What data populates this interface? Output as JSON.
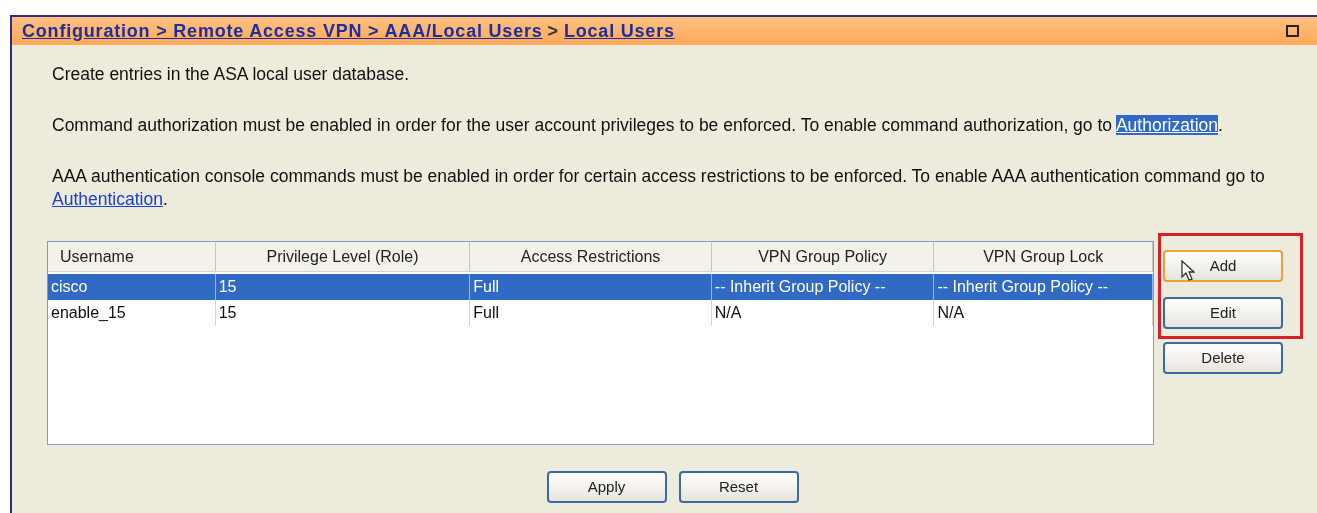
{
  "breadcrumb": [
    {
      "kind": "link",
      "text": "Configuration > Remote Access VPN > AAA/Local Users"
    },
    {
      "kind": "separator",
      "text": ">"
    },
    {
      "kind": "link",
      "text": "Local Users"
    }
  ],
  "paragraphs": [
    [
      {
        "kind": "text",
        "text": "Create entries in the ASA local user database."
      }
    ],
    [
      {
        "kind": "text",
        "text": "Command authorization must be enabled in order for the user account privileges to be enforced. To enable command authorization, go to "
      },
      {
        "kind": "link",
        "text": "Authorization",
        "highlighted": true
      },
      {
        "kind": "text",
        "text": "."
      }
    ],
    [
      {
        "kind": "text",
        "text": "AAA authentication console commands must be enabled in order for certain access restrictions to be enforced. To enable AAA authentication command go to "
      },
      {
        "kind": "link",
        "text": "Authentication",
        "highlighted": false
      },
      {
        "kind": "text",
        "text": "."
      }
    ]
  ],
  "table": {
    "columns": [
      "Username",
      "Privilege Level (Role)",
      "Access Restrictions",
      "VPN Group Policy",
      "VPN Group Lock"
    ],
    "rows": [
      {
        "cells": [
          "cisco",
          "15",
          "Full",
          "-- Inherit Group Policy --",
          "-- Inherit Group Policy --"
        ],
        "selected": true
      },
      {
        "cells": [
          "enable_15",
          "15",
          "Full",
          "N/A",
          "N/A"
        ],
        "selected": false
      }
    ]
  },
  "side_buttons": [
    {
      "framed": true,
      "buttons": [
        {
          "label": "Add",
          "focused": true
        },
        {
          "label": "Edit",
          "focused": false
        }
      ]
    },
    {
      "framed": false,
      "buttons": [
        {
          "label": "Delete",
          "focused": false
        }
      ]
    }
  ],
  "bottom_buttons": [
    "Apply",
    "Reset"
  ]
}
